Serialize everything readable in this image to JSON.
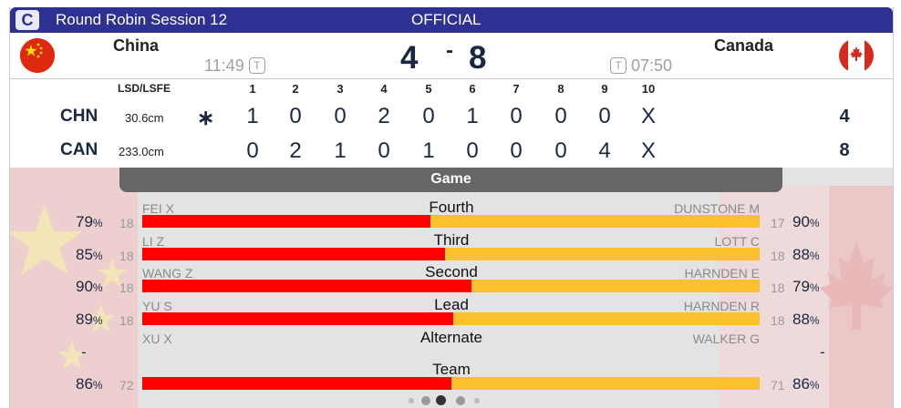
{
  "header": {
    "badge": "C",
    "session": "Round Robin Session 12",
    "status": "OFFICIAL"
  },
  "teams": {
    "home": {
      "name": "China",
      "code": "CHN",
      "time": "11:49",
      "timeout_icon": "T",
      "score": "4",
      "lsd": "30.6cm",
      "hammer": "∗",
      "ends": [
        "1",
        "0",
        "0",
        "2",
        "0",
        "1",
        "0",
        "0",
        "0",
        "X"
      ],
      "total": "4"
    },
    "away": {
      "name": "Canada",
      "code": "CAN",
      "time": "07:50",
      "timeout_icon": "T",
      "score": "8",
      "lsd": "233.0cm",
      "ends": [
        "0",
        "2",
        "1",
        "0",
        "1",
        "0",
        "0",
        "0",
        "4",
        "X"
      ],
      "total": "8"
    }
  },
  "score_separator": "-",
  "linescore": {
    "lsd_header": "LSD/LSFE",
    "end_numbers": [
      "1",
      "2",
      "3",
      "4",
      "5",
      "6",
      "7",
      "8",
      "9",
      "10"
    ]
  },
  "stats": {
    "tab": "Game",
    "pct_unit": "%",
    "rows": [
      {
        "position": "Fourth",
        "home_player": "FEI X",
        "away_player": "DUNSTONE M",
        "home_shots": "18",
        "away_shots": "17",
        "home_pct": "79",
        "away_pct": "90",
        "home_share": 0.467
      },
      {
        "position": "Third",
        "home_player": "LI Z",
        "away_player": "LOTT C",
        "home_shots": "18",
        "away_shots": "18",
        "home_pct": "85",
        "away_pct": "88",
        "home_share": 0.49
      },
      {
        "position": "Second",
        "home_player": "WANG Z",
        "away_player": "HARNDEN E",
        "home_shots": "18",
        "away_shots": "18",
        "home_pct": "90",
        "away_pct": "79",
        "home_share": 0.533
      },
      {
        "position": "Lead",
        "home_player": "YU S",
        "away_player": "HARNDEN R",
        "home_shots": "18",
        "away_shots": "18",
        "home_pct": "89",
        "away_pct": "88",
        "home_share": 0.503
      },
      {
        "position": "Alternate",
        "home_player": "XU X",
        "away_player": "WALKER G",
        "home_shots": "",
        "away_shots": "",
        "home_pct": "-",
        "away_pct": "-",
        "home_share": null
      },
      {
        "position": "Team",
        "home_player": "",
        "away_player": "",
        "home_shots": "72",
        "away_shots": "71",
        "home_pct": "86",
        "away_pct": "86",
        "home_share": 0.5
      }
    ]
  },
  "pager": {
    "count": 5,
    "active": 2
  },
  "colors": {
    "title_bar": "#2e3192",
    "home_bar": "#ff0000",
    "away_bar": "#fbc02d",
    "china_red": "#de2910",
    "canada_red": "#d52b1e"
  }
}
